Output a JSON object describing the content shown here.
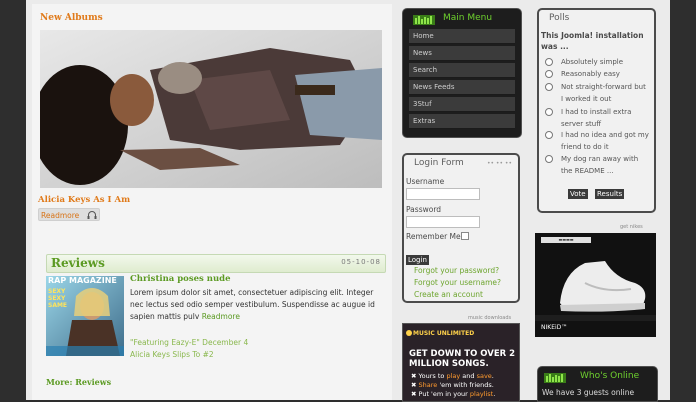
{
  "albums": {
    "heading": "New Albums",
    "caption": "Alicia Keys As I Am",
    "read_more": "Readmore"
  },
  "reviews": {
    "heading": "Reviews",
    "date": "05-10-08",
    "magazine_title": "RAP MAGAZINE",
    "magazine_side": "SEXY SEXY SAME",
    "item_title": "Christina poses nude",
    "item_text": "Lorem ipsum dolor sit amet, consectetuer adipiscing elit. Integer nec lectus sed odio semper vestibulum. Suspendisse ac augue id sapien mattis pulv",
    "item_more": "Readmore",
    "links": [
      "\"Featuring Eazy-E\" December 4",
      "Alicia Keys Slips To #2"
    ],
    "more": "More: Reviews"
  },
  "main_menu": {
    "title": "Main Menu",
    "items": [
      "Home",
      "News",
      "Search",
      "News Feeds",
      "3Stuf",
      "Extras"
    ]
  },
  "login": {
    "title": "Login Form",
    "username_label": "Username",
    "password_label": "Password",
    "remember_label": "Remember Me",
    "login_button": "Login",
    "forgot_password": "Forgot your password?",
    "forgot_username": "Forgot your username?",
    "create_account": "Create an account"
  },
  "music_ad": {
    "label": "music downloads",
    "brand": "MUSIC UNLIMITED",
    "headline": "GET DOWN TO OVER 2 MILLION SONGS.",
    "lines": [
      {
        "pre": "Yours to ",
        "hl1": "play",
        "mid": " and ",
        "hl2": "save",
        "post": "."
      },
      {
        "pre": "",
        "hl1": "Share",
        "mid": " 'em with friends.",
        "hl2": "",
        "post": ""
      },
      {
        "pre": "Put 'em in your ",
        "hl1": "playlist",
        "mid": "",
        "hl2": "",
        "post": "."
      }
    ]
  },
  "polls": {
    "title": "Polls",
    "question": "This Joomla! installation was ...",
    "options": [
      "Absolutely simple",
      "Reasonably easy",
      "Not straight-forward but I worked it out",
      "I had to install extra server stuff",
      "I had no idea and got my friend to do it",
      "My dog ran away with the README ..."
    ],
    "vote_button": "Vote",
    "results_button": "Results"
  },
  "shoe_ad": {
    "label": "get nikes",
    "brand": "NIKEiD™"
  },
  "whos_online": {
    "title": "Who's Online",
    "text": "We have 3 guests online"
  },
  "colors": {
    "accent_orange": "#e07a1a",
    "accent_green": "#5b9a22",
    "menu_green": "#6ed12e",
    "dark_panel": "#1d1d1d"
  }
}
